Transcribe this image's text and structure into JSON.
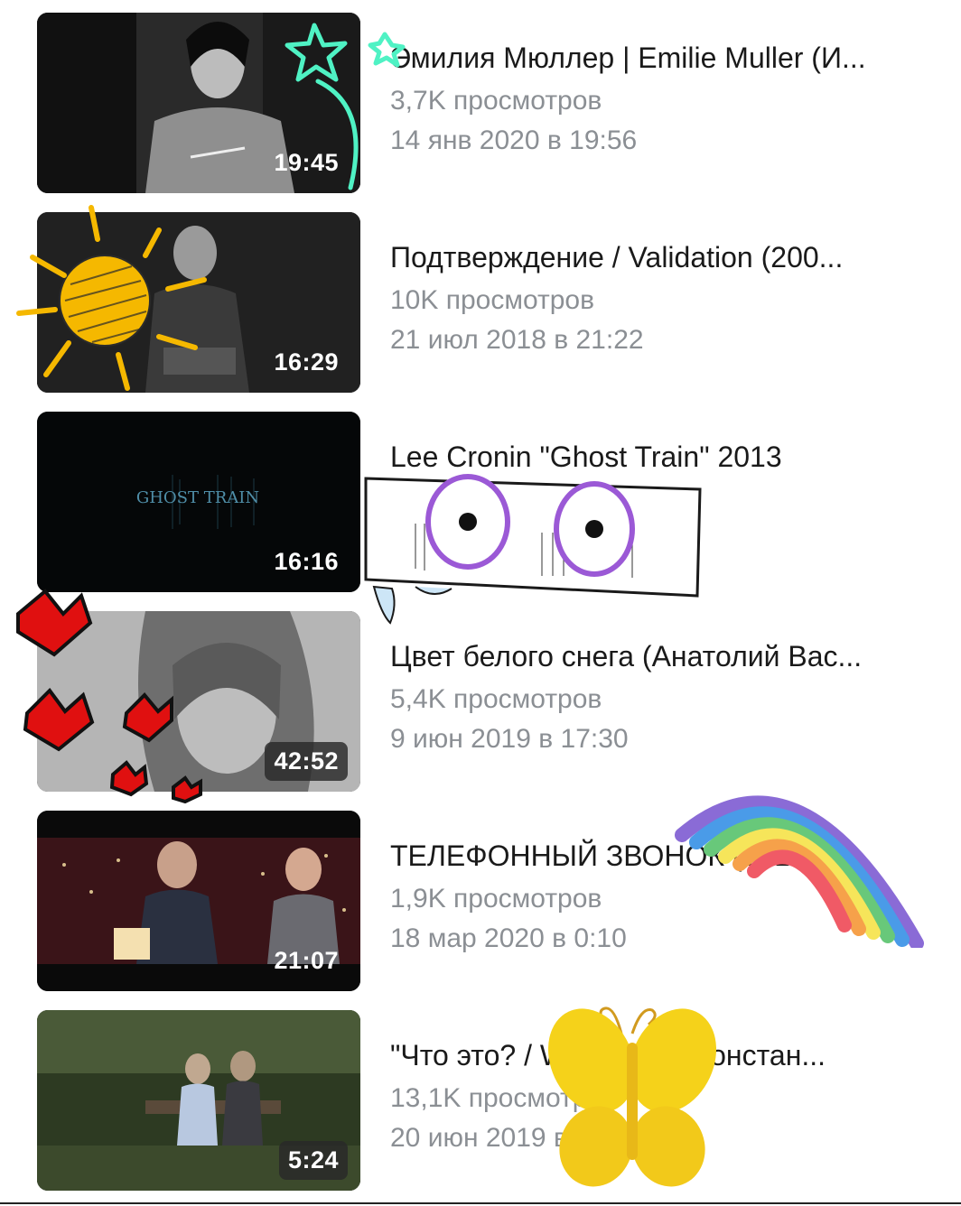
{
  "videos": [
    {
      "title": "Эмилия Мюллер | Emilie Muller (И...",
      "views": "3,7K просмотров",
      "date": "14 янв 2020 в 19:56",
      "duration": "19:45"
    },
    {
      "title": "Подтверждение / Validation (200...",
      "views": "10K просмотров",
      "date": "21 июл 2018 в 21:22",
      "duration": "16:29"
    },
    {
      "title": "Lee Cronin \"Ghost Train\" 2013",
      "views": "",
      "date": "",
      "duration": "16:16",
      "thumb_text": "GHOST TRAIN"
    },
    {
      "title": "Цвет белого снега (Анатолий Вас...",
      "views": "5,4K просмотров",
      "date": "9 июн 2019 в 17:30",
      "duration": "42:52"
    },
    {
      "title": "ТЕЛЕФОННЫЙ ЗВОНОК (2013) ...",
      "views": "1,9K просмотров",
      "date": "18 мар 2020 в 0:10",
      "duration": "21:07"
    },
    {
      "title": "\"Что это? / What is it?\" Констан...",
      "views": "13,1K просмотров",
      "date": "20 июн 2019 в 10:00",
      "duration": "5:24"
    }
  ],
  "stickers": [
    "star-wand-sticker",
    "sun-sticker",
    "googly-eyes-sticker",
    "pixel-hearts-sticker",
    "rainbow-sticker",
    "butterfly-sticker"
  ],
  "colors": {
    "title": "#1a1a1a",
    "meta": "#8b8f94",
    "neon": "#4ff2c4",
    "sun": "#f5b800",
    "heart": "#e01010",
    "eyes": "#9b59d6",
    "butterfly": "#f5d21a"
  }
}
